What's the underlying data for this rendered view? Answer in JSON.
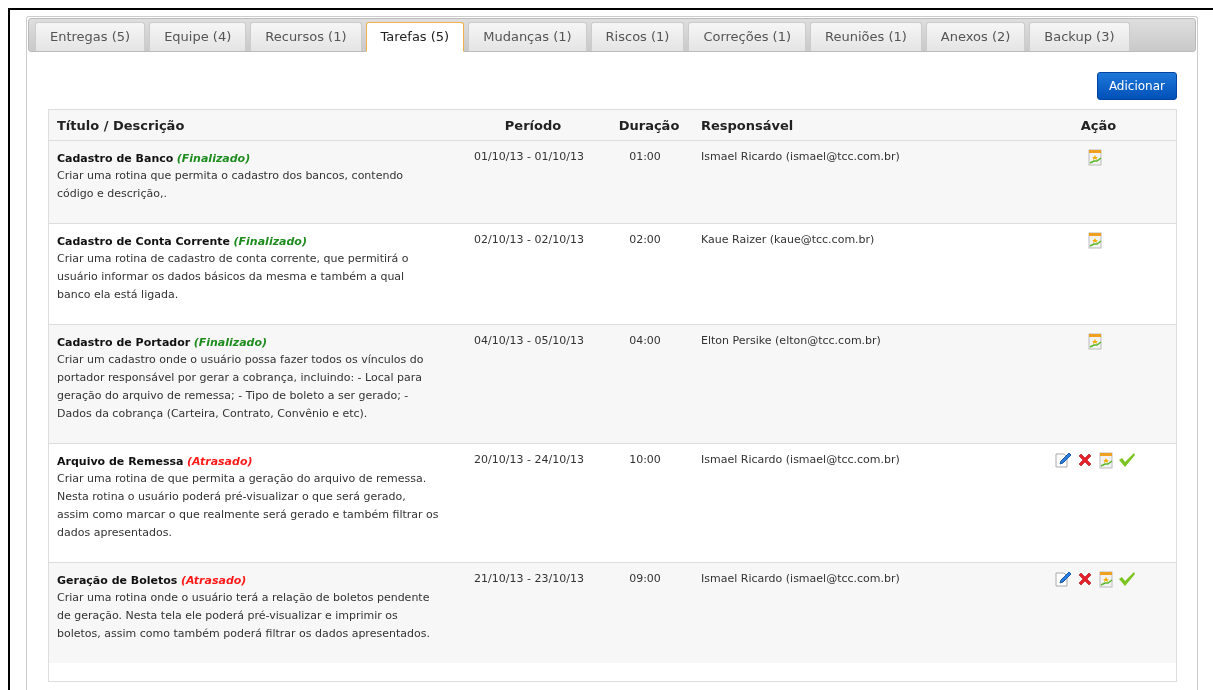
{
  "tabs": [
    {
      "label": "Entregas (5)",
      "selected": false
    },
    {
      "label": "Equipe (4)",
      "selected": false
    },
    {
      "label": "Recursos (1)",
      "selected": false
    },
    {
      "label": "Tarefas (5)",
      "selected": true
    },
    {
      "label": "Mudanças (1)",
      "selected": false
    },
    {
      "label": "Riscos (1)",
      "selected": false
    },
    {
      "label": "Correções (1)",
      "selected": false
    },
    {
      "label": "Reuniões (1)",
      "selected": false
    },
    {
      "label": "Anexos (2)",
      "selected": false
    },
    {
      "label": "Backup (3)",
      "selected": false
    }
  ],
  "add_button": "Adicionar",
  "table": {
    "columns": [
      "Título / Descrição",
      "Período",
      "Duração",
      "Responsável",
      "Ação"
    ],
    "rows": [
      {
        "title": "Cadastro de Banco",
        "status": {
          "text": "(Finalizado)",
          "color": "#1e8c1e"
        },
        "description": "Criar uma rotina que permita o cadastro dos bancos, contendo código e descrição,.",
        "period": "01/10/13 - 01/10/13",
        "duration": "01:00",
        "responsible": "Ismael Ricardo (ismael@tcc.com.br)",
        "actions": [
          {
            "kind": "report"
          }
        ]
      },
      {
        "title": "Cadastro de Conta Corrente",
        "status": {
          "text": "(Finalizado)",
          "color": "#1e8c1e"
        },
        "description": "Criar uma rotina de cadastro de conta corrente, que permitirá o usuário informar os dados básicos da mesma e também a qual banco ela está ligada.",
        "period": "02/10/13 - 02/10/13",
        "duration": "02:00",
        "responsible": "Kaue Raizer (kaue@tcc.com.br)",
        "actions": [
          {
            "kind": "report"
          }
        ]
      },
      {
        "title": "Cadastro de Portador",
        "status": {
          "text": "(Finalizado)",
          "color": "#1e8c1e"
        },
        "description": "Criar um cadastro onde o usuário possa fazer todos os vínculos do portador responsável por gerar a cobrança, incluindo: - Local para geração do arquivo de remessa; - Tipo de boleto a ser gerado; - Dados da cobrança (Carteira, Contrato, Convênio e etc).",
        "period": "04/10/13 - 05/10/13",
        "duration": "04:00",
        "responsible": "Elton Persike (elton@tcc.com.br)",
        "actions": [
          {
            "kind": "report"
          }
        ]
      },
      {
        "title": "Arquivo de Remessa",
        "status": {
          "text": "(Atrasado)",
          "color": "#ff1a1a"
        },
        "description": "Criar uma rotina de que permita a geração do arquivo de remessa. Nesta rotina o usuário poderá pré-visualizar o que será gerado, assim como marcar o que realmente será gerado e também filtrar os dados apresentados.",
        "period": "20/10/13 - 24/10/13",
        "duration": "10:00",
        "responsible": "Ismael Ricardo (ismael@tcc.com.br)",
        "actions": [
          {
            "kind": "edit"
          },
          {
            "kind": "delete"
          },
          {
            "kind": "report"
          },
          {
            "kind": "approve"
          }
        ]
      },
      {
        "title": "Geração de Boletos",
        "status": {
          "text": "(Atrasado)",
          "color": "#ff1a1a"
        },
        "description": "Criar uma rotina onde o usuário terá a relação de boletos pendente de geração. Nesta tela ele poderá pré-visualizar e imprimir os boletos, assim como também poderá filtrar os dados apresentados.",
        "period": "21/10/13 - 23/10/13",
        "duration": "09:00",
        "responsible": "Ismael Ricardo (ismael@tcc.com.br)",
        "actions": [
          {
            "kind": "edit"
          },
          {
            "kind": "delete"
          },
          {
            "kind": "report"
          },
          {
            "kind": "approve"
          }
        ]
      }
    ]
  }
}
